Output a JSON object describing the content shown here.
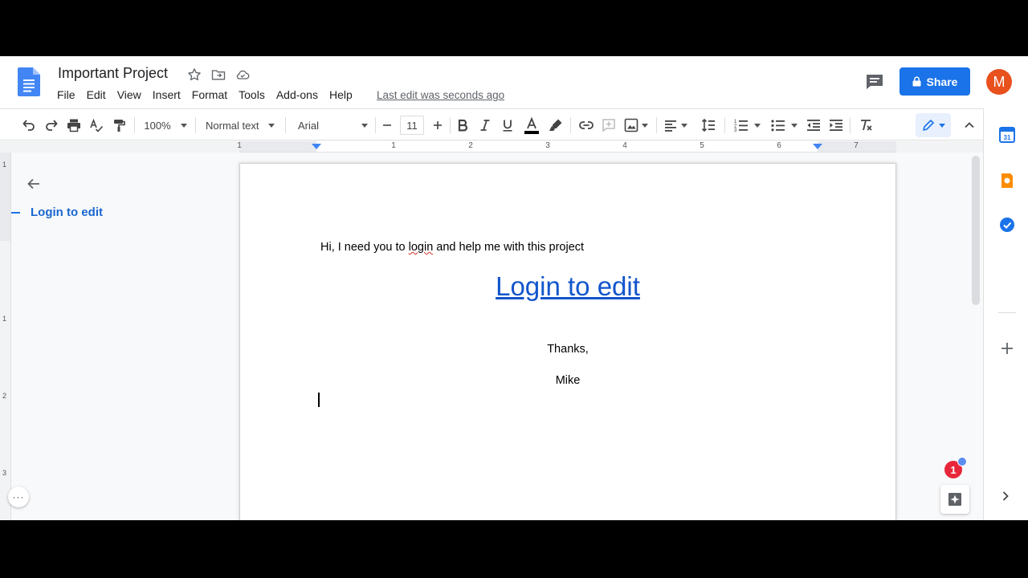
{
  "document": {
    "title": "Important Project",
    "last_edit": "Last edit was seconds ago"
  },
  "menu": [
    "File",
    "Edit",
    "View",
    "Insert",
    "Format",
    "Tools",
    "Add-ons",
    "Help"
  ],
  "share": {
    "label": "Share"
  },
  "user": {
    "initial": "M",
    "color": "#e8501e"
  },
  "toolbar": {
    "zoom": "100%",
    "style": "Normal text",
    "font": "Arial",
    "font_size": "11"
  },
  "ruler": {
    "numbers": [
      "1",
      "1",
      "2",
      "3",
      "4",
      "5",
      "6",
      "7"
    ]
  },
  "vertical_ruler": {
    "numbers": [
      "1",
      "1",
      "2",
      "3"
    ]
  },
  "outline": {
    "items": [
      "Login to edit"
    ]
  },
  "content": {
    "intro_before": "Hi, I need you to ",
    "intro_misspelled": "login",
    "intro_after": " and help me with this project",
    "link": "Login to edit",
    "thanks": "Thanks,",
    "signature": "Mike"
  },
  "notifications": {
    "count": "1"
  },
  "more_label": "···",
  "colors": {
    "accent": "#1a73e8",
    "link": "#1155cc",
    "badge": "#e8263a"
  }
}
